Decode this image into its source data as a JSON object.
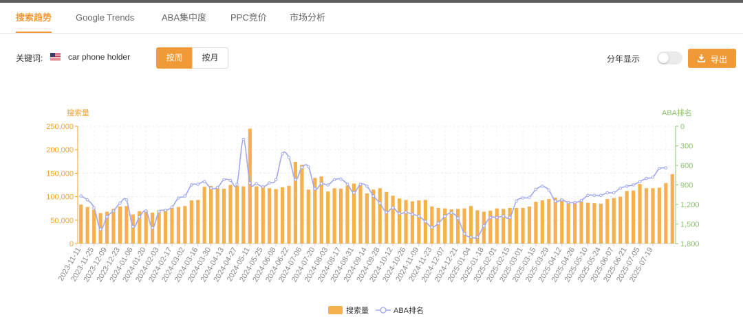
{
  "tabs": [
    {
      "label": "搜索趋势",
      "active": true
    },
    {
      "label": "Google Trends",
      "active": false
    },
    {
      "label": "ABA集中度",
      "active": false
    },
    {
      "label": "PPC竞价",
      "active": false
    },
    {
      "label": "市场分析",
      "active": false
    }
  ],
  "toolbar": {
    "keyword_label": "关键词:",
    "flag_icon": "us-flag-icon",
    "keyword": "car phone holder",
    "by_week": "按周",
    "by_month": "按月",
    "selected_period": "按周",
    "yearly_display_label": "分年显示",
    "yearly_display_on": false,
    "export_label": "导出",
    "export_icon": "download-icon"
  },
  "colors": {
    "accent": "#f09a37",
    "bar": "#f5b14e",
    "line": "#9fa7ef",
    "right_axis": "#8cc36b",
    "left_axis_text": "#f0a030"
  },
  "chart_data": {
    "type": "bar+line",
    "left_axis_title": "搜索量",
    "right_axis_title": "ABA排名",
    "left_ylim": [
      0,
      250000
    ],
    "left_ticks": [
      "0",
      "50,000",
      "100,000",
      "150,000",
      "200,000",
      "250,000"
    ],
    "right_ylim": [
      0,
      1800
    ],
    "right_inverted": true,
    "right_ticks": [
      "0",
      "300",
      "600",
      "900",
      "1,200",
      "1,500",
      "1,800"
    ],
    "x_tick_labels": [
      "2023-11-11",
      "2023-11-25",
      "2023-12-09",
      "2023-12-23",
      "2024-01-06",
      "2024-01-20",
      "2024-02-03",
      "2024-02-17",
      "2024-03-02",
      "2024-03-16",
      "2024-03-30",
      "2024-04-13",
      "2024-04-27",
      "2024-05-11",
      "2024-05-25",
      "2024-06-08",
      "2024-06-22",
      "2024-07-06",
      "2024-07-20",
      "2024-08-03",
      "2024-08-17",
      "2024-08-31",
      "2024-09-14",
      "2024-09-28",
      "2024-10-12",
      "2024-10-26",
      "2024-11-09",
      "2024-11-23",
      "2024-12-07",
      "2024-12-21",
      "2025-01-04",
      "2025-01-18",
      "2025-02-01",
      "2025-02-15",
      "2025-03-01",
      "2025-03-15",
      "2025-03-29",
      "2025-04-12",
      "2025-04-26",
      "2025-05-10",
      "2025-05-24",
      "2025-06-07",
      "2025-06-21",
      "2025-07-05",
      "2025-07-19"
    ],
    "grid": true,
    "legend_position": "bottom-center",
    "series": [
      {
        "name": "搜索量",
        "kind": "bar",
        "values": [
          83000,
          78000,
          72000,
          65000,
          68000,
          74000,
          79000,
          80000,
          62000,
          69000,
          71000,
          66000,
          71000,
          73000,
          76000,
          78000,
          80000,
          92000,
          93000,
          121000,
          123000,
          118000,
          117000,
          125000,
          123000,
          122000,
          245000,
          122000,
          122000,
          118000,
          116000,
          120000,
          123000,
          174000,
          168000,
          115000,
          140000,
          143000,
          111000,
          118000,
          117000,
          123000,
          128000,
          124000,
          107000,
          115000,
          118000,
          110000,
          102000,
          96000,
          93000,
          90000,
          92000,
          93000,
          79000,
          76000,
          75000,
          73000,
          74000,
          75000,
          80000,
          71000,
          68000,
          70000,
          75000,
          74000,
          76000,
          76000,
          76000,
          79000,
          89000,
          92000,
          95000,
          98000,
          95000,
          87000,
          89000,
          89000,
          87000,
          86000,
          85000,
          95000,
          97000,
          100000,
          112000,
          113000,
          127000,
          118000,
          118000,
          119000,
          129000,
          148000
        ]
      },
      {
        "name": "ABA排名",
        "kind": "line",
        "values": [
          1070,
          1130,
          1250,
          1580,
          1390,
          1300,
          1180,
          1130,
          1540,
          1390,
          1300,
          1560,
          1310,
          1290,
          1240,
          1100,
          1070,
          900,
          890,
          850,
          950,
          940,
          820,
          830,
          890,
          200,
          870,
          880,
          930,
          870,
          820,
          420,
          480,
          820,
          630,
          620,
          960,
          880,
          900,
          820,
          810,
          890,
          1020,
          890,
          920,
          1070,
          1180,
          1320,
          1250,
          1340,
          1320,
          1350,
          1380,
          1460,
          1550,
          1490,
          1380,
          1330,
          1410,
          1650,
          1700,
          1700,
          1530,
          1400,
          1400,
          1380,
          1400,
          1150,
          1100,
          1090,
          970,
          920,
          980,
          1150,
          1130,
          1170,
          1170,
          1140,
          1060,
          1060,
          1060,
          1020,
          1020,
          950,
          920,
          900,
          850,
          800,
          780,
          650,
          640
        ]
      }
    ]
  }
}
